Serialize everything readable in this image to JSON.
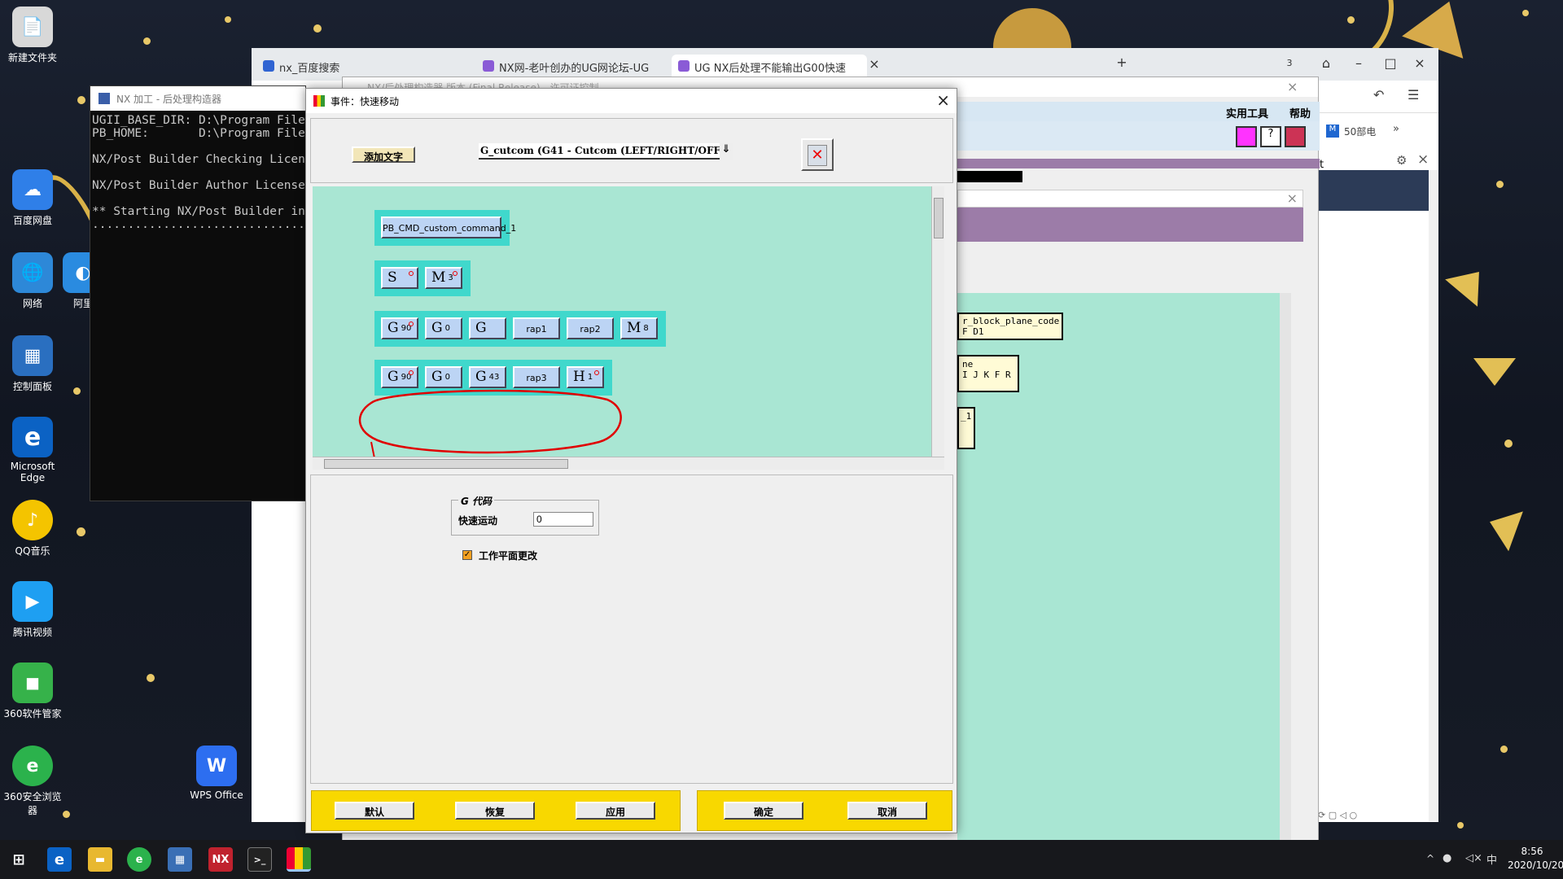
{
  "desktop": {
    "icons": [
      {
        "label": "新建文件夹",
        "glyph": "📄",
        "color": "#d8d8d8"
      },
      {
        "label": "百度网盘",
        "glyph": "☁",
        "color": "#2f7fe8"
      },
      {
        "label": "网络",
        "glyph": "🌐",
        "color": "#2d88d8"
      },
      {
        "label": "阿里",
        "glyph": "◐",
        "color": "#2a8be0"
      },
      {
        "label": "控制面板",
        "glyph": "▦",
        "color": "#2a6fc0"
      },
      {
        "label": "Microsoft Edge",
        "glyph": "e",
        "color": "#0b62c4"
      },
      {
        "label": "QQ音乐",
        "glyph": "♪",
        "color": "#f4c400"
      },
      {
        "label": "腾讯视频",
        "glyph": "▶",
        "color": "#1e9ff2"
      },
      {
        "label": "360软件管家",
        "glyph": "◼",
        "color": "#36b24a"
      },
      {
        "label": "360安全浏览器",
        "glyph": "e",
        "color": "#2bb24c"
      },
      {
        "label": "WPS Office",
        "glyph": "W",
        "color": "#2d6ef0"
      }
    ]
  },
  "browser": {
    "tabs": [
      {
        "label": "nx_百度搜索",
        "active": false
      },
      {
        "label": "NX网-老叶创办的UG网论坛-UG",
        "active": false
      },
      {
        "label": "UG NX后处理不能输出G00快速",
        "active": true
      }
    ],
    "new_tab": "+",
    "tab_count": "3",
    "side_text": "50部电",
    "side_more": "»"
  },
  "console": {
    "title": "NX 加工 - 后处理构造器",
    "lines": [
      "UGII_BASE_DIR: D:\\Program Files\\S",
      "PB_HOME:       D:\\Program Files\\S",
      "",
      "NX/Post Builder Checking License",
      "",
      "NX/Post Builder Author License Us",
      "",
      "** Starting NX/Post Builder in D:",
      "................................."
    ]
  },
  "pb_main": {
    "title": "NX/后处理构造器 版本 (Final Release) - 许可证控制",
    "menu": [
      "实用工具",
      "帮助"
    ],
    "right_blocks": [
      {
        "line1": "r_block_plane_code",
        "line2": "F D1"
      },
      {
        "line1": "ne",
        "line2": "I J K F R"
      },
      {
        "line1": "_1",
        "line2": ""
      }
    ],
    "side_label": "t"
  },
  "dialog": {
    "title": "事件：快速移动",
    "add_text_button": "添加文字",
    "command_select": "G_cutcom (G41 - Cutcom (LEFT/RIGHT/OFF))",
    "rows": [
      {
        "blocks": [
          {
            "label": "PB_CMD_custom_command_1",
            "sub": "",
            "small": true,
            "dot": false
          }
        ]
      },
      {
        "blocks": [
          {
            "label": "S",
            "sub": "",
            "small": false,
            "dot": true
          },
          {
            "label": "M",
            "sub": "3",
            "small": false,
            "dot": true
          }
        ]
      },
      {
        "blocks": [
          {
            "label": "G",
            "sub": "90",
            "small": false,
            "dot": true
          },
          {
            "label": "G",
            "sub": "0",
            "small": false,
            "dot": false
          },
          {
            "label": "G",
            "sub": "",
            "small": false,
            "dot": false
          },
          {
            "label": "rap1",
            "sub": "",
            "small": true,
            "dot": false
          },
          {
            "label": "rap2",
            "sub": "",
            "small": true,
            "dot": false
          },
          {
            "label": "M",
            "sub": "8",
            "small": false,
            "dot": false
          }
        ]
      },
      {
        "blocks": [
          {
            "label": "G",
            "sub": "90",
            "small": false,
            "dot": true
          },
          {
            "label": "G",
            "sub": "0",
            "small": false,
            "dot": false
          },
          {
            "label": "G",
            "sub": "43",
            "small": false,
            "dot": false
          },
          {
            "label": "rap3",
            "sub": "",
            "small": true,
            "dot": false
          },
          {
            "label": "H",
            "sub": "1",
            "small": false,
            "dot": true
          }
        ]
      }
    ],
    "gcode_group_title": "G 代码",
    "rapid_label": "快速运动",
    "rapid_value": "0",
    "workplane_checkbox": "工作平面更改",
    "workplane_checked": true,
    "footer_left": [
      "默认",
      "恢复",
      "应用"
    ],
    "footer_right": [
      "确定",
      "取消"
    ],
    "colors": {
      "canvas": "#a9e6d3",
      "row": "#40d8cc",
      "block": "#bcd4f4",
      "footer": "#f8d800",
      "annotation": "#e00000"
    }
  },
  "taskbar": {
    "time": "8:56",
    "date": "2020/10/20",
    "ime": "中",
    "apps": [
      "start-icon",
      "edge-icon",
      "explorer-icon",
      "browser360-icon",
      "calculator-icon",
      "nx-icon",
      "terminal-icon",
      "postbuilder-icon"
    ]
  }
}
